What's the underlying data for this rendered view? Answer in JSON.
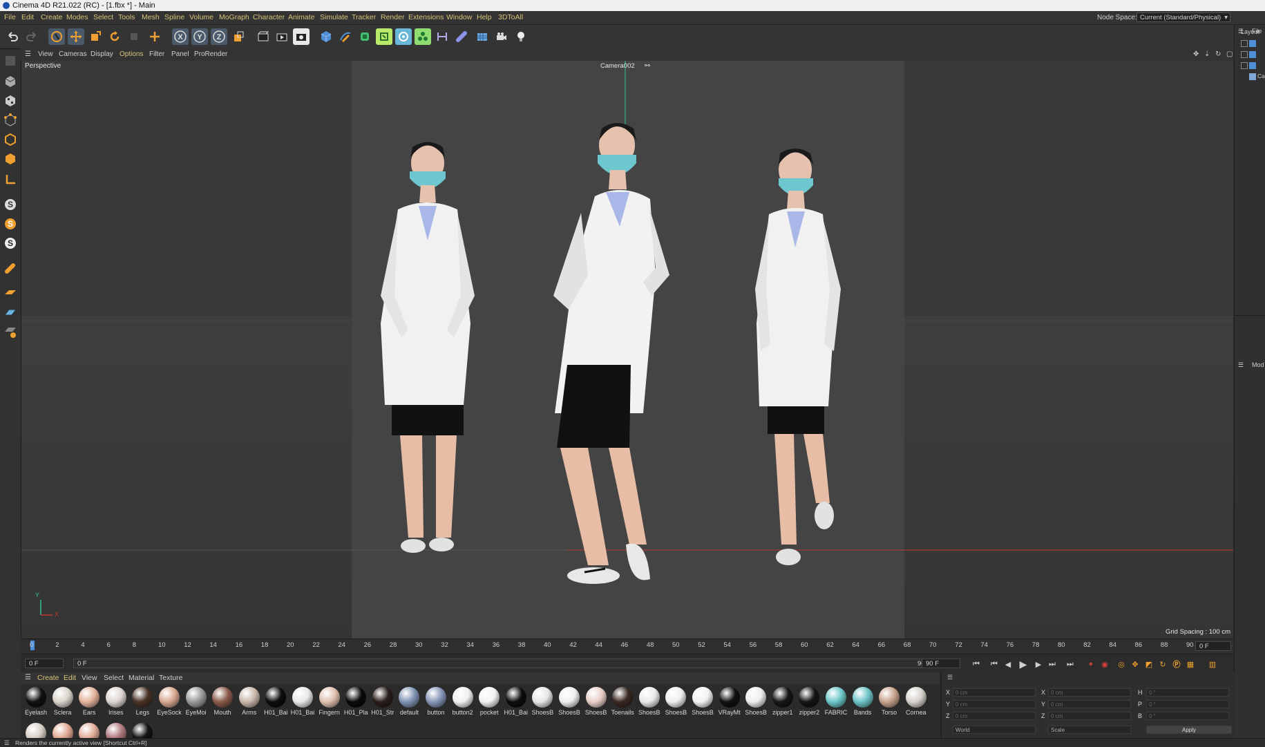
{
  "window": {
    "title": "Cinema 4D R21.022 (RC) - [1.fbx *] - Main"
  },
  "menu": [
    "File",
    "Edit",
    "Create",
    "Modes",
    "Select",
    "Tools",
    "Mesh",
    "Spline",
    "Volume",
    "MoGraph",
    "Character",
    "Animate",
    "Simulate",
    "Tracker",
    "Render",
    "Extensions",
    "Window",
    "Help",
    "3DToAll"
  ],
  "node_space": {
    "label": "Node Space:",
    "value": "Current (Standard/Physical)"
  },
  "viewport": {
    "menu": [
      "View",
      "Cameras",
      "Display",
      "Options",
      "Filter",
      "Panel",
      "ProRender"
    ],
    "view_name": "Perspective",
    "camera": "Camera002",
    "grid_spacing": "Grid Spacing : 100 cm",
    "axis_x": "X",
    "axis_y": "Y"
  },
  "right_panel": {
    "file_label": "File",
    "layout_label": "Layout",
    "mode_label": "Mod",
    "object_item": "Ca"
  },
  "timeline": {
    "ticks": [
      "0",
      "2",
      "4",
      "6",
      "8",
      "10",
      "12",
      "14",
      "16",
      "18",
      "20",
      "22",
      "24",
      "26",
      "28",
      "30",
      "32",
      "34",
      "36",
      "38",
      "40",
      "42",
      "44",
      "46",
      "48",
      "50",
      "52",
      "54",
      "56",
      "58",
      "60",
      "62",
      "64",
      "66",
      "68",
      "70",
      "72",
      "74",
      "76",
      "78",
      "80",
      "82",
      "84",
      "86",
      "88",
      "90"
    ],
    "current_frame": "0 F",
    "start_frame": "0 F",
    "range_start": "0 F",
    "range_end": "90 F",
    "end_frame": "90 F"
  },
  "material_menu": [
    "Create",
    "Edit",
    "View",
    "Select",
    "Material",
    "Texture"
  ],
  "materials": [
    {
      "name": "Eyelash",
      "color": "#111111"
    },
    {
      "name": "Sclera",
      "color": "#d9d3cb"
    },
    {
      "name": "Ears",
      "color": "#e3b29c"
    },
    {
      "name": "Irises",
      "color": "#ddd5d0"
    },
    {
      "name": "Legs",
      "color": "#4a3326"
    },
    {
      "name": "EyeSock",
      "color": "#d8a88f"
    },
    {
      "name": "EyeMoi",
      "color": "#9a9a9a"
    },
    {
      "name": "Mouth",
      "color": "#8a5a4a"
    },
    {
      "name": "Arms",
      "color": "#c9b8ac"
    },
    {
      "name": "H01_Bai",
      "color": "#0d0d0d"
    },
    {
      "name": "H01_Bai",
      "color": "#e8e8e8"
    },
    {
      "name": "Fingern",
      "color": "#e0c0b0"
    },
    {
      "name": "H01_Pla",
      "color": "#0b0b0b"
    },
    {
      "name": "H01_Str",
      "color": "#2a1f1a"
    },
    {
      "name": "default",
      "color": "#7f93b3"
    },
    {
      "name": "button",
      "color": "#8596b5"
    },
    {
      "name": "button2",
      "color": "#f0f0f0"
    },
    {
      "name": "pocket",
      "color": "#f2f2f2"
    },
    {
      "name": "H01_Bai",
      "color": "#0e0e0e"
    },
    {
      "name": "ShoesB",
      "color": "#e6e6e6"
    },
    {
      "name": "ShoesB",
      "color": "#f0f0f0"
    },
    {
      "name": "ShoesB",
      "color": "#e8d0c8"
    },
    {
      "name": "Toenails",
      "color": "#3a2a24"
    },
    {
      "name": "ShoesB",
      "color": "#eaeaea"
    },
    {
      "name": "ShoesB",
      "color": "#eeeeee"
    },
    {
      "name": "ShoesB",
      "color": "#f2f2f2"
    },
    {
      "name": "VRayMt",
      "color": "#111111"
    },
    {
      "name": "ShoesB",
      "color": "#ededed"
    },
    {
      "name": "zipper1",
      "color": "#161616"
    },
    {
      "name": "zipper2",
      "color": "#151515"
    },
    {
      "name": "FABRIC",
      "color": "#6cc7c9"
    },
    {
      "name": "Bands",
      "color": "#6dc3c6"
    },
    {
      "name": "Torso",
      "color": "#c8a28c"
    },
    {
      "name": "Cornea",
      "color": "#d6d2cc"
    }
  ],
  "materials_row2": [
    {
      "color": "#d8d0c8"
    },
    {
      "color": "#e0a892"
    },
    {
      "color": "#e2ad98"
    },
    {
      "color": "#b07a80"
    },
    {
      "color": "#141414"
    }
  ],
  "attributes": {
    "x_label": "X",
    "y_label": "Y",
    "z_label": "Z",
    "h_label": "H",
    "p_label": "P",
    "b_label": "B",
    "pos_x": "0 cm",
    "pos_y": "0 cm",
    "pos_z": "0 cm",
    "size_x": "0 cm",
    "size_y": "0 cm",
    "size_z": "0 cm",
    "rot_h": "0 °",
    "rot_p": "0 °",
    "rot_b": "0 °",
    "coord_mode": "World",
    "size_mode": "Scale",
    "apply_label": "Apply"
  },
  "status": "Renders the currently active view [Shortcut Ctrl+R]",
  "colors": {
    "menu_text": "#d8c47a",
    "accent_orange": "#f0a030",
    "accent_blue": "#4f8fd8"
  }
}
